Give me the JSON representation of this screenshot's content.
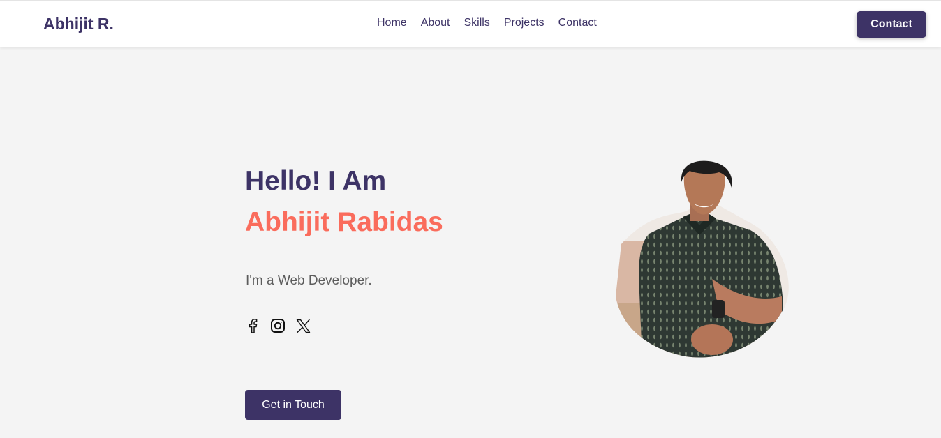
{
  "nav": {
    "brand": "Abhijit R.",
    "links": [
      "Home",
      "About",
      "Skills",
      "Projects",
      "Contact"
    ],
    "cta_label": "Contact"
  },
  "hero": {
    "greeting": "Hello! I Am",
    "name": "Abhijit Rabidas",
    "role": "I'm a Web Developer.",
    "cta_label": "Get in Touch",
    "socials": [
      "facebook-icon",
      "instagram-icon",
      "x-icon"
    ],
    "portrait": "profile-photo"
  },
  "colors": {
    "primary": "#3d3366",
    "accent": "#fa6c5c",
    "background": "#f4f4f4",
    "text_muted": "#5c5c5c"
  }
}
